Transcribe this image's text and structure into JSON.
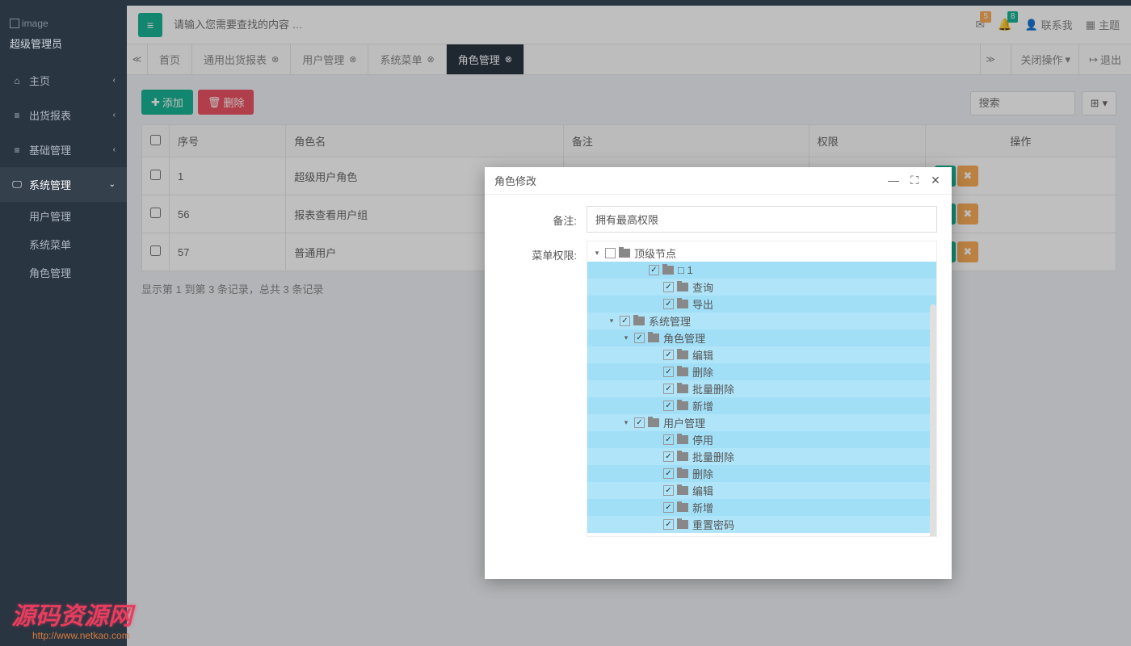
{
  "sidebar": {
    "logo_text": "image",
    "admin": "超级管理员",
    "items": [
      {
        "icon": "home",
        "label": "主页"
      },
      {
        "icon": "list",
        "label": "出货报表"
      },
      {
        "icon": "list",
        "label": "基础管理"
      },
      {
        "icon": "desktop",
        "label": "系统管理",
        "active": true
      }
    ],
    "sub_items": [
      "用户管理",
      "系统菜单",
      "角色管理"
    ]
  },
  "header": {
    "search_placeholder": "请输入您需要查找的内容 …",
    "badge_mail": "5",
    "badge_bell": "8",
    "contact": "联系我",
    "theme": "主题"
  },
  "tabs": {
    "items": [
      {
        "label": "首页",
        "closable": false
      },
      {
        "label": "通用出货报表",
        "closable": true
      },
      {
        "label": "用户管理",
        "closable": true
      },
      {
        "label": "系统菜单",
        "closable": true
      },
      {
        "label": "角色管理",
        "closable": true,
        "active": true
      }
    ],
    "close_ops": "关闭操作",
    "logout": "退出"
  },
  "toolbar": {
    "add": "添加",
    "delete": "删除"
  },
  "table": {
    "search_placeholder": "搜索",
    "headers": [
      "序号",
      "角色名",
      "备注",
      "权限",
      "操作"
    ],
    "rows": [
      {
        "id": "1",
        "name": "超级用户角色",
        "remark": "拥有最高权限",
        "perm": "-"
      },
      {
        "id": "56",
        "name": "报表查看用户组",
        "remark": "",
        "perm": ""
      },
      {
        "id": "57",
        "name": "普通用户",
        "remark": "",
        "perm": ""
      }
    ],
    "footer": "显示第 1 到第 3 条记录，总共 3 条记录"
  },
  "modal": {
    "title": "角色修改",
    "remark_label": "备注:",
    "remark_value": "拥有最高权限",
    "perm_label": "菜单权限:",
    "tree": [
      {
        "depth": 0,
        "toggle": "▾",
        "checked": false,
        "label": "顶级节点",
        "hl": false
      },
      {
        "depth": 3,
        "toggle": "",
        "checked": true,
        "label": "□ 1",
        "hl": true
      },
      {
        "depth": 4,
        "toggle": "",
        "checked": true,
        "label": "查询",
        "hl": true
      },
      {
        "depth": 4,
        "toggle": "",
        "checked": true,
        "label": "导出",
        "hl": true
      },
      {
        "depth": 1,
        "toggle": "▾",
        "checked": true,
        "label": "系统管理",
        "hl": true
      },
      {
        "depth": 2,
        "toggle": "▾",
        "checked": true,
        "label": "角色管理",
        "hl": true
      },
      {
        "depth": 4,
        "toggle": "",
        "checked": true,
        "label": "编辑",
        "hl": true
      },
      {
        "depth": 4,
        "toggle": "",
        "checked": true,
        "label": "删除",
        "hl": true
      },
      {
        "depth": 4,
        "toggle": "",
        "checked": true,
        "label": "批量删除",
        "hl": true
      },
      {
        "depth": 4,
        "toggle": "",
        "checked": true,
        "label": "新增",
        "hl": true
      },
      {
        "depth": 2,
        "toggle": "▾",
        "checked": true,
        "label": "用户管理",
        "hl": true
      },
      {
        "depth": 4,
        "toggle": "",
        "checked": true,
        "label": "停用",
        "hl": true
      },
      {
        "depth": 4,
        "toggle": "",
        "checked": true,
        "label": "批量删除",
        "hl": true
      },
      {
        "depth": 4,
        "toggle": "",
        "checked": true,
        "label": "删除",
        "hl": true
      },
      {
        "depth": 4,
        "toggle": "",
        "checked": true,
        "label": "编辑",
        "hl": true
      },
      {
        "depth": 4,
        "toggle": "",
        "checked": true,
        "label": "新增",
        "hl": true
      },
      {
        "depth": 4,
        "toggle": "",
        "checked": true,
        "label": "重置密码",
        "hl": true
      }
    ]
  },
  "watermark": {
    "main": "源码资源网",
    "sub": "http://www.netkao.com"
  }
}
